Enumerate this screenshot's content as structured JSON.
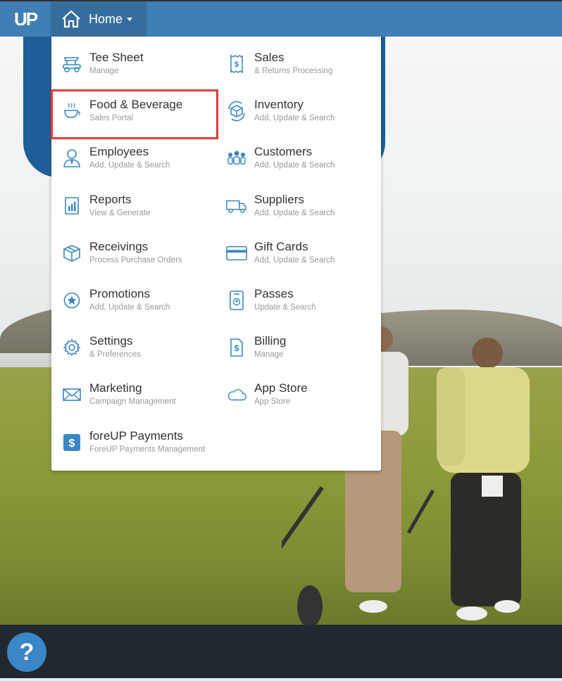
{
  "topbar": {
    "logo": "UP",
    "home_label": "Home"
  },
  "menu": {
    "left": [
      {
        "title": "Tee Sheet",
        "sub": "Manage",
        "icon": "golf-cart-icon"
      },
      {
        "title": "Food & Beverage",
        "sub": "Sales Portal",
        "icon": "coffee-cup-icon"
      },
      {
        "title": "Employees",
        "sub": "Add, Update & Search",
        "icon": "employee-icon"
      },
      {
        "title": "Reports",
        "sub": "View & Generate",
        "icon": "report-icon"
      },
      {
        "title": "Receivings",
        "sub": "Process Purchase Orders",
        "icon": "box-icon"
      },
      {
        "title": "Promotions",
        "sub": "Add, Update & Search",
        "icon": "star-badge-icon"
      },
      {
        "title": "Settings",
        "sub": "& Preferences",
        "icon": "gear-icon"
      },
      {
        "title": "Marketing",
        "sub": "Campaign Management",
        "icon": "envelope-icon"
      },
      {
        "title": "foreUP Payments",
        "sub": "ForeUP Payments Management",
        "icon": "dollar-square-icon"
      }
    ],
    "right": [
      {
        "title": "Sales",
        "sub": "& Returns Processing",
        "icon": "receipt-icon"
      },
      {
        "title": "Inventory",
        "sub": "Add, Update & Search",
        "icon": "inventory-box-icon"
      },
      {
        "title": "Customers",
        "sub": "Add, Update & Search",
        "icon": "customers-icon"
      },
      {
        "title": "Suppliers",
        "sub": "Add, Update & Search",
        "icon": "truck-icon"
      },
      {
        "title": "Gift Cards",
        "sub": "Add, Update & Search",
        "icon": "credit-card-icon"
      },
      {
        "title": "Passes",
        "sub": "Update & Search",
        "icon": "pass-icon"
      },
      {
        "title": "Billing",
        "sub": "Manage",
        "icon": "billing-icon"
      },
      {
        "title": "App Store",
        "sub": "App Store",
        "icon": "cloud-icon"
      }
    ]
  },
  "help": {
    "label": "?"
  },
  "colors": {
    "accent": "#3f7fb5",
    "icon": "#3a86c6",
    "highlight": "#e53935"
  }
}
